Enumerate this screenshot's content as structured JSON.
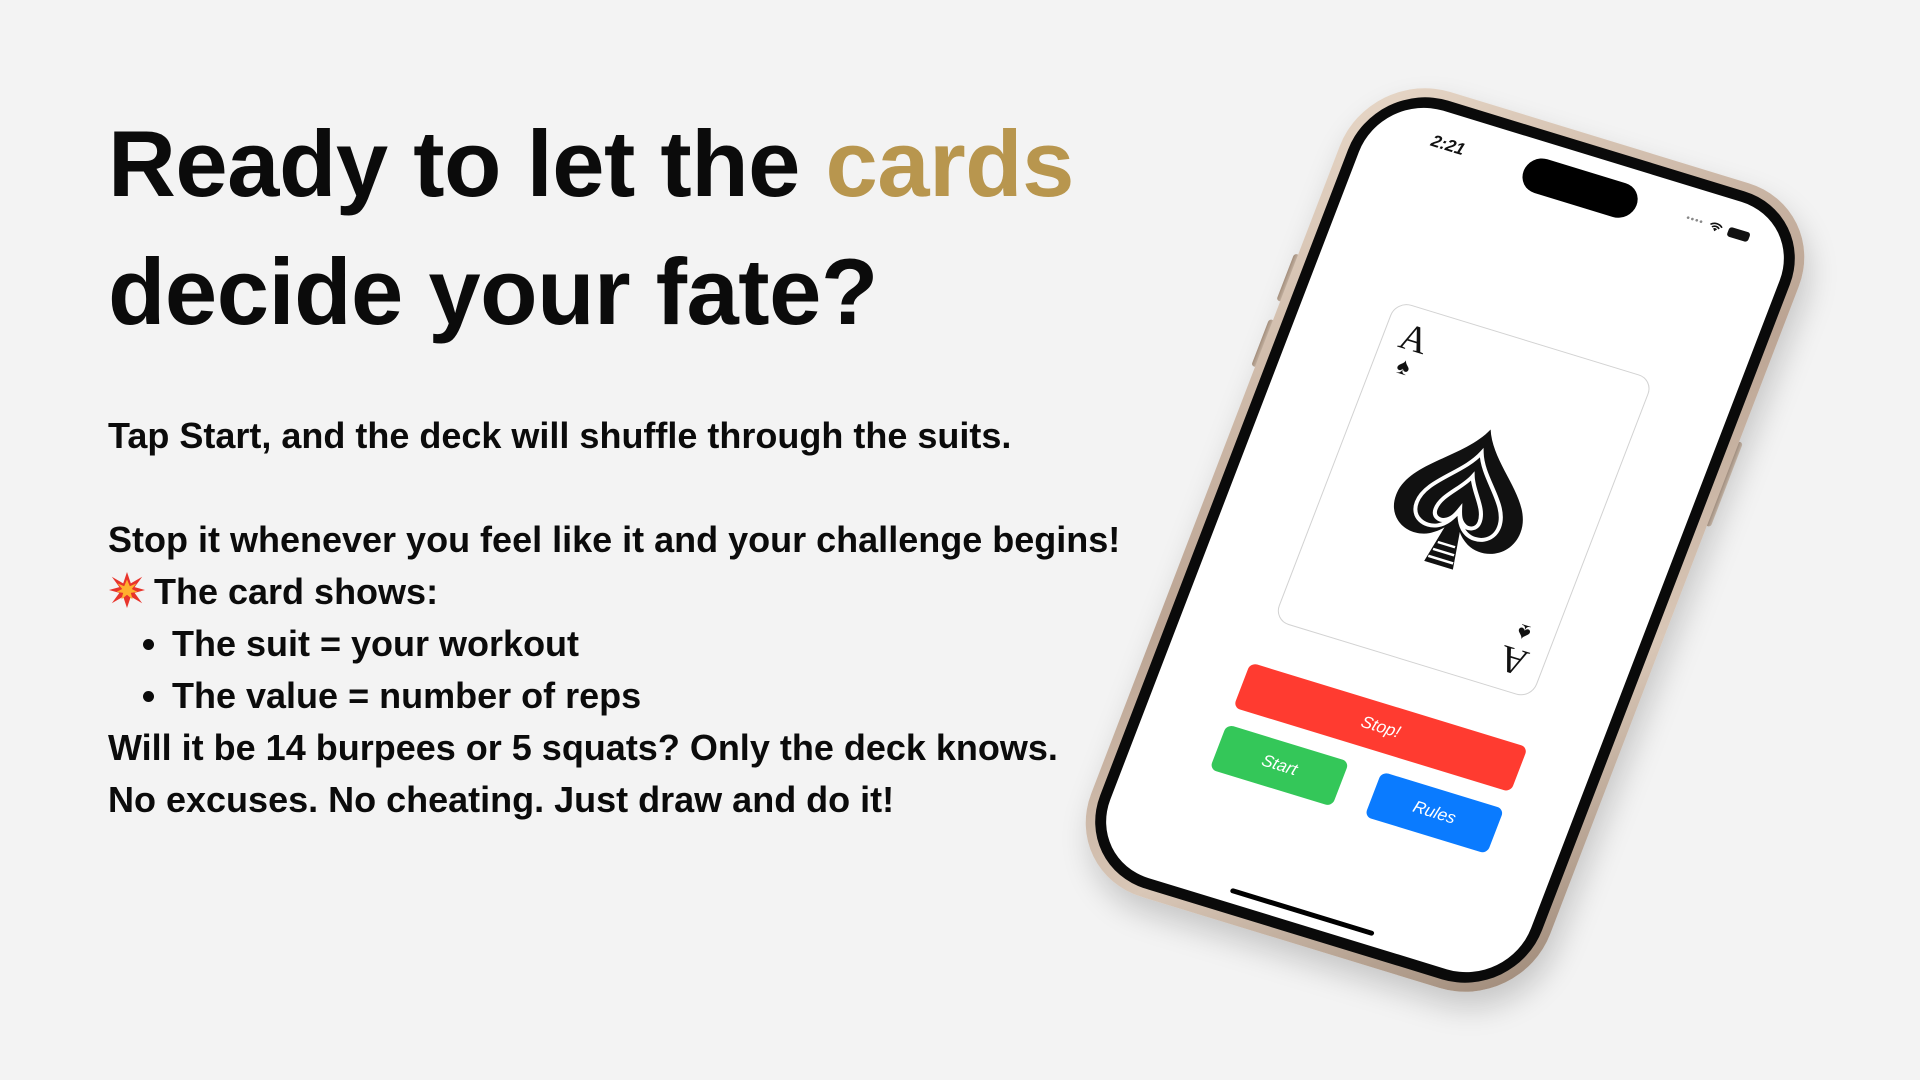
{
  "headline": {
    "before": "Ready to let the ",
    "accent": "cards",
    "after": " decide your fate?",
    "accent_color": "#b8964e"
  },
  "body": {
    "line1": "Tap Start, and the deck will shuffle through the suits.",
    "line2": "Stop it whenever you feel like it and your challenge begins!",
    "card_shows_icon": "collision-emoji",
    "card_shows": "The card shows:",
    "bullets": [
      "The suit = your workout",
      "The value = number of reps"
    ],
    "line3": "Will it be 14 burpees or 5 squats? Only the deck knows.",
    "line4": "No excuses. No cheating. Just draw and do it!"
  },
  "phone": {
    "status_time": "2:21",
    "card": {
      "rank": "A",
      "suit_symbol": "♠",
      "suit_name": "spade-icon"
    },
    "buttons": {
      "stop": "Stop!",
      "start": "Start",
      "rules": "Rules"
    },
    "colors": {
      "stop": "#ff3b30",
      "start": "#34c759",
      "rules": "#0a7bff"
    }
  }
}
